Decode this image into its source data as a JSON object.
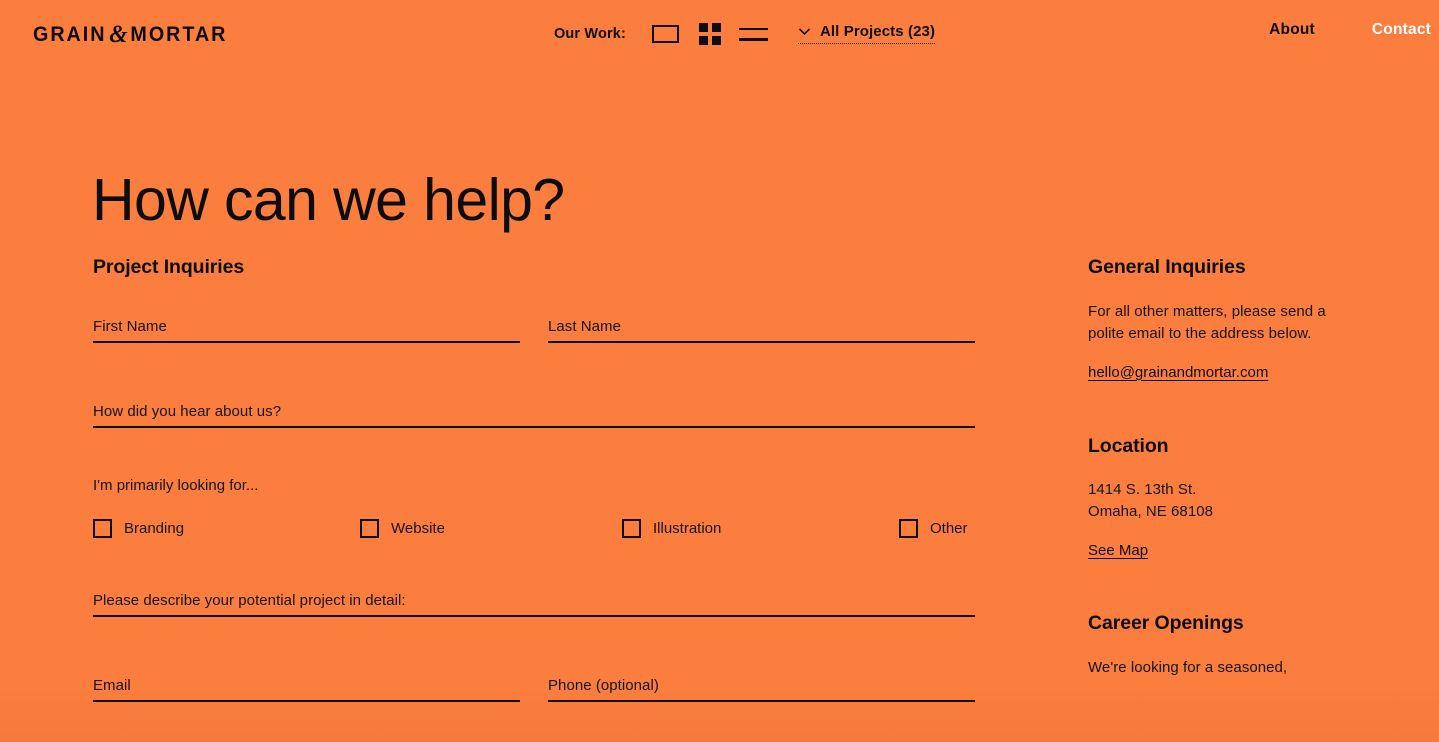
{
  "theme": {
    "background": "#fb7e3e",
    "ink": "#0d0d0d",
    "active_nav": "#ffffff"
  },
  "header": {
    "logo": {
      "part1": "GRAIN",
      "ampersand": "&",
      "part2": "MORTAR"
    },
    "our_work_label": "Our Work:",
    "view_modes": [
      {
        "name": "single-view",
        "icon": "rectangle-outline-icon"
      },
      {
        "name": "grid-view",
        "icon": "grid-2x2-icon"
      },
      {
        "name": "list-view",
        "icon": "list-lines-icon"
      }
    ],
    "projects_dropdown": {
      "icon": "chevron-down-icon",
      "label": "All Projects (23)"
    },
    "nav": {
      "about": "About",
      "contact": "Contact"
    }
  },
  "page": {
    "title": "How can we help?"
  },
  "form": {
    "heading": "Project Inquiries",
    "first_name": {
      "label": "First Name",
      "value": ""
    },
    "last_name": {
      "label": "Last Name",
      "value": ""
    },
    "how_heard": {
      "label": "How did you hear about us?",
      "value": ""
    },
    "looking_for_prompt": "I'm primarily looking for...",
    "options": [
      {
        "label": "Branding",
        "checked": false
      },
      {
        "label": "Website",
        "checked": false
      },
      {
        "label": "Illustration",
        "checked": false
      },
      {
        "label": "Other",
        "checked": false
      }
    ],
    "describe": {
      "label": "Please describe your potential project in detail:",
      "value": ""
    },
    "email": {
      "label": "Email",
      "value": ""
    },
    "phone": {
      "label": "Phone (optional)",
      "value": ""
    }
  },
  "sidebar": {
    "general": {
      "heading": "General Inquiries",
      "text": "For all other matters, please send a polite email to the address below.",
      "email_link": "hello@grainandmortar.com"
    },
    "location": {
      "heading": "Location",
      "address_line1": "1414 S. 13th St.",
      "address_line2": "Omaha, NE 68108",
      "map_link": "See Map"
    },
    "careers": {
      "heading": "Career Openings",
      "text": "We're looking for a seasoned,"
    }
  }
}
